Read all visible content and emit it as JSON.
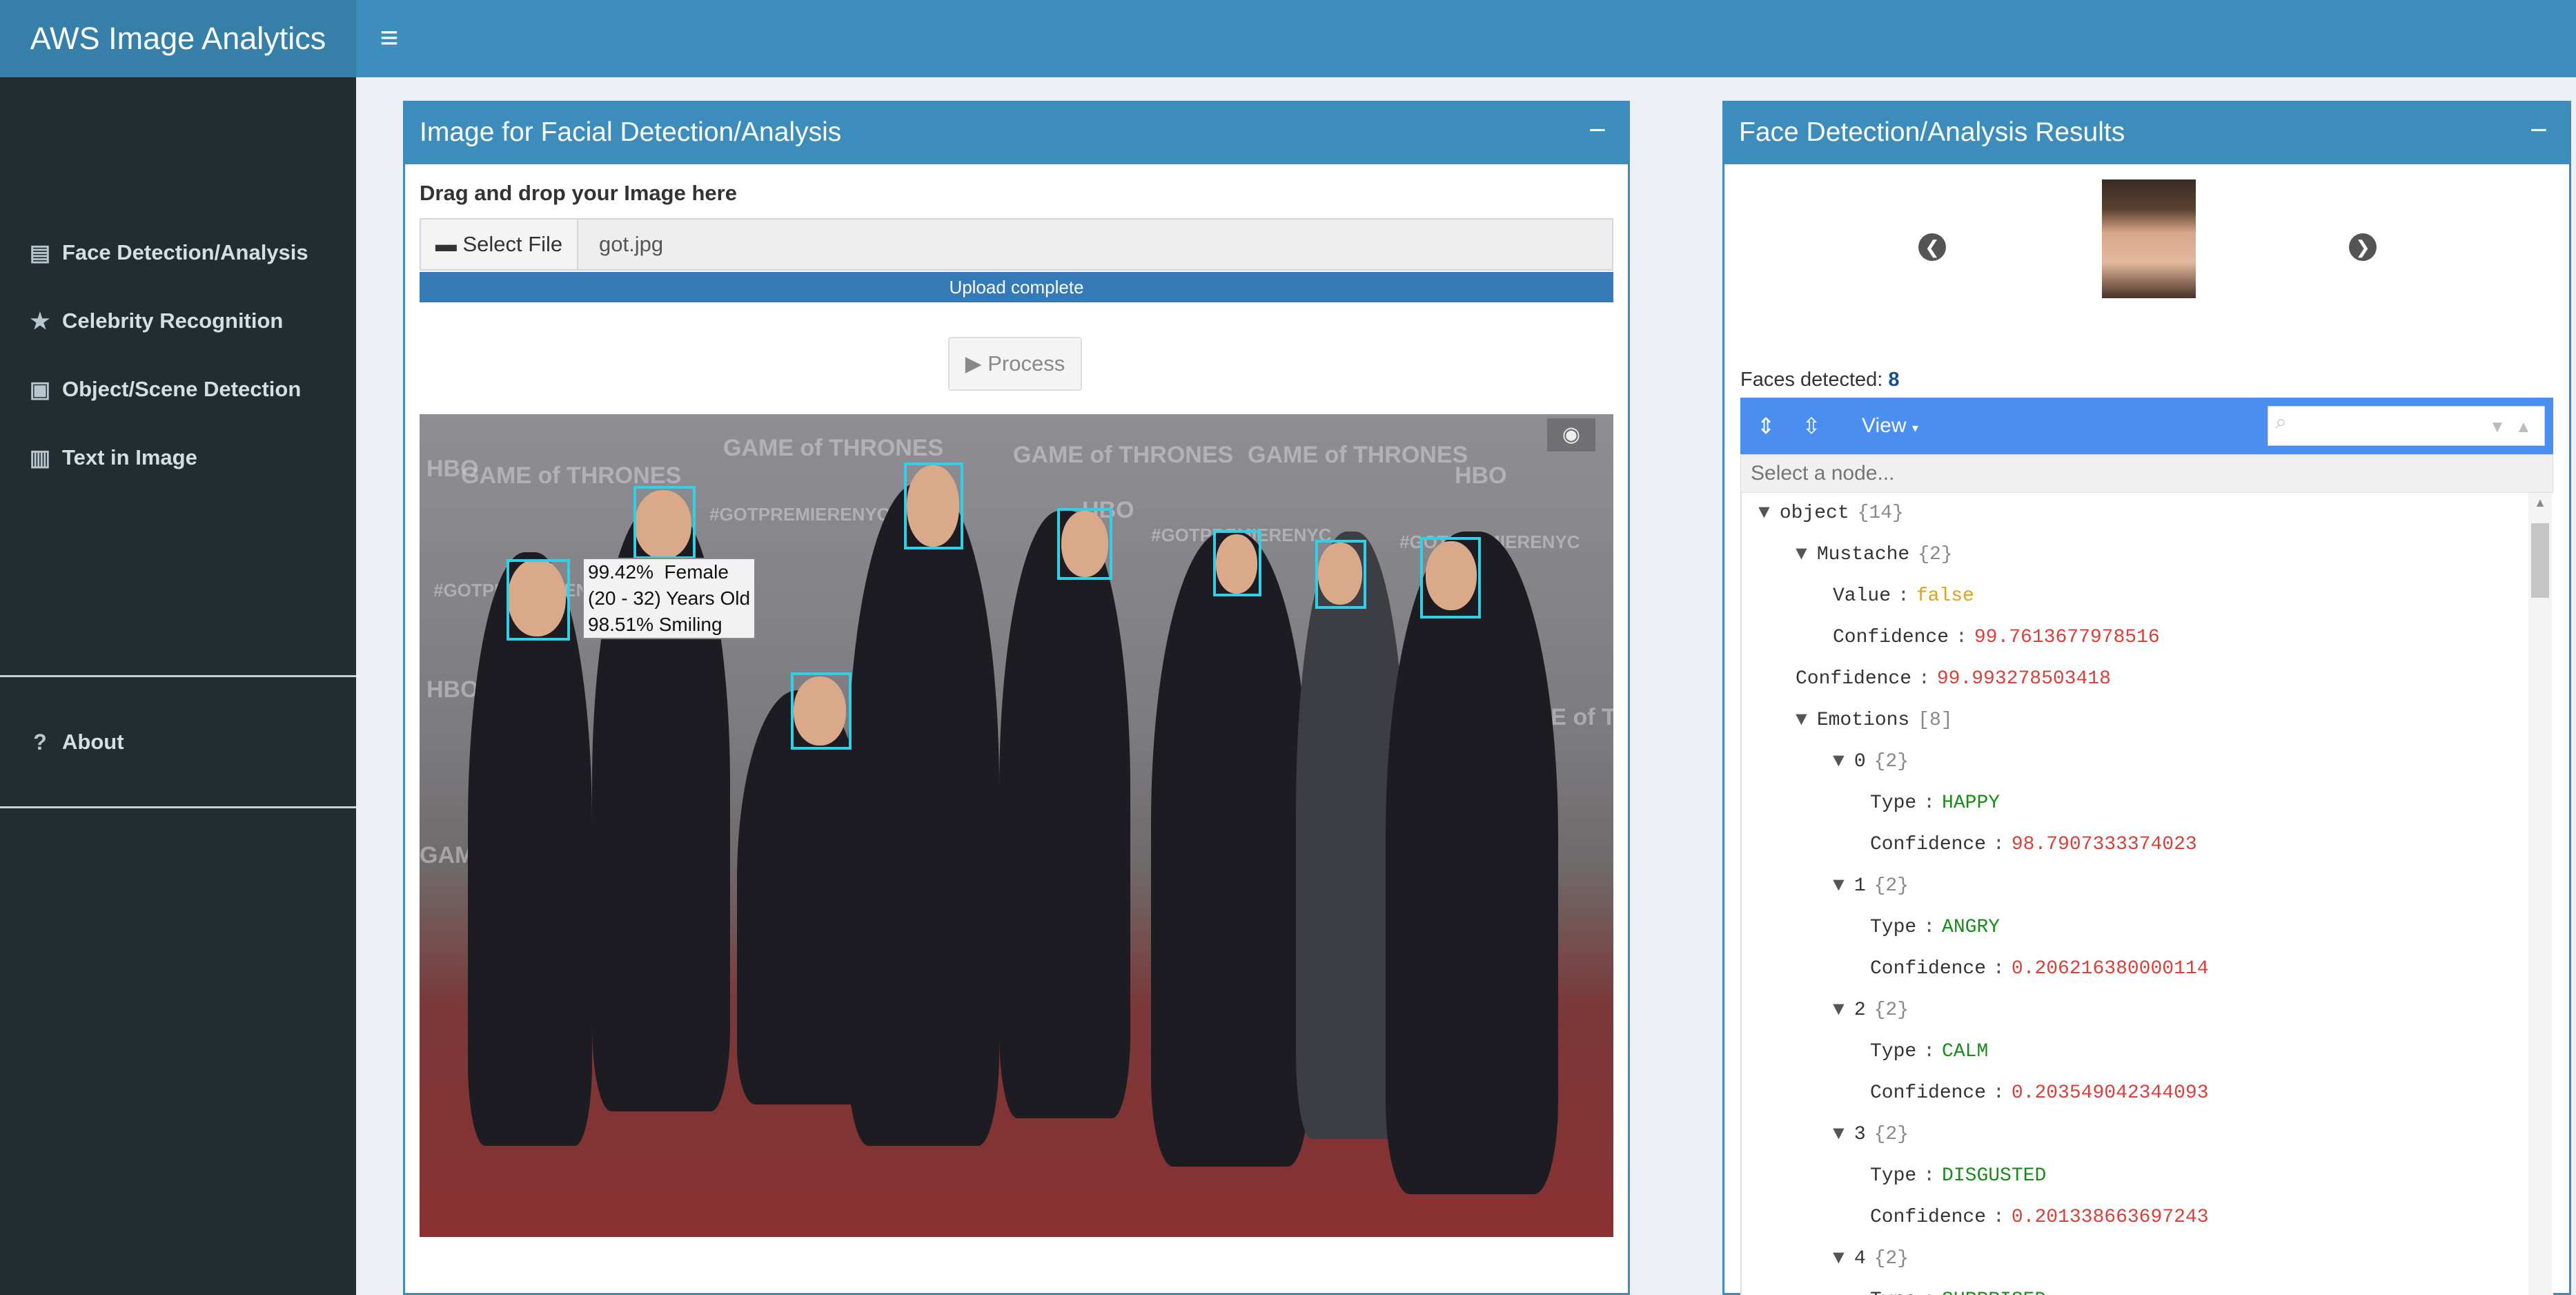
{
  "app": {
    "title": "AWS Image Analytics"
  },
  "sidebar": {
    "items": [
      {
        "label": "Face Detection/Analysis"
      },
      {
        "label": "Celebrity Recognition"
      },
      {
        "label": "Object/Scene Detection"
      },
      {
        "label": "Text in Image"
      },
      {
        "label": "About"
      }
    ]
  },
  "left_panel": {
    "title": "Image for Facial Detection/Analysis",
    "drop_label": "Drag and drop your Image here",
    "select_file_label": "Select File",
    "file_name": "got.jpg",
    "upload_status": "Upload complete",
    "upload_progress": 1.0,
    "process_label": "Process",
    "tooltip": {
      "line1": "99.42%  Female",
      "line2": "(20 - 32) Years Old",
      "line3": "98.51% Smiling"
    },
    "watermarks": [
      "HBO",
      "GAME of THRONES",
      "#GOTPREMIERENYC"
    ]
  },
  "right_panel": {
    "title": "Face Detection/Analysis Results",
    "faces_label": "Faces detected:",
    "faces_count": "8",
    "view_label": "View",
    "node_placeholder": "Select a node...",
    "tree": [
      {
        "key": "object",
        "count": "{14}"
      },
      {
        "key": "Mustache",
        "count": "{2}"
      },
      {
        "key": "Value",
        "value": "false"
      },
      {
        "key": "Confidence",
        "value": "99.7613677978516"
      },
      {
        "key": "Confidence",
        "value": "99.993278503418"
      },
      {
        "key": "Emotions",
        "count": "[8]"
      },
      {
        "key": "0",
        "count": "{2}"
      },
      {
        "key": "Type",
        "value": "HAPPY"
      },
      {
        "key": "Confidence",
        "value": "98.7907333374023"
      },
      {
        "key": "1",
        "count": "{2}"
      },
      {
        "key": "Type",
        "value": "ANGRY"
      },
      {
        "key": "Confidence",
        "value": "0.206216380000114"
      },
      {
        "key": "2",
        "count": "{2}"
      },
      {
        "key": "Type",
        "value": "CALM"
      },
      {
        "key": "Confidence",
        "value": "0.203549042344093"
      },
      {
        "key": "3",
        "count": "{2}"
      },
      {
        "key": "Type",
        "value": "DISGUSTED"
      },
      {
        "key": "Confidence",
        "value": "0.201338663697243"
      },
      {
        "key": "4",
        "count": "{2}"
      },
      {
        "key": "Type",
        "value": "SURPRISED"
      }
    ]
  },
  "colors": {
    "primary": "#3c8dbc",
    "sidebar": "#222d32",
    "accent": "#2fd0e8"
  }
}
